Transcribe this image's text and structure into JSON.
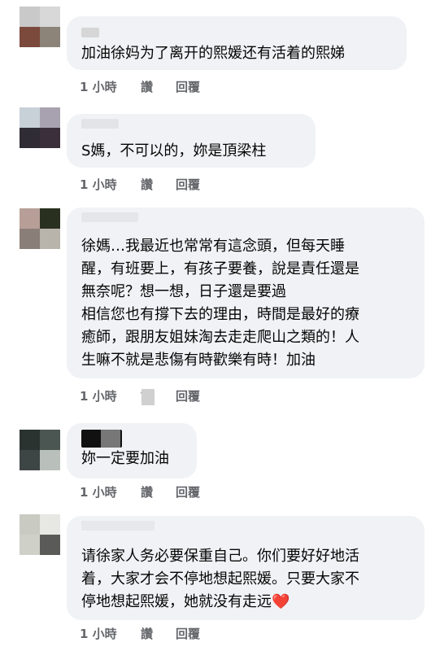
{
  "comments": [
    {
      "text": "加油徐妈为了离开的熙媛还有活着的熙娣",
      "time": "1 小時",
      "like": "讚",
      "reply": "回覆"
    },
    {
      "text": "S媽，不可以的，妳是頂梁柱",
      "time": "1 小時",
      "like": "讚",
      "reply": "回覆"
    },
    {
      "text": "徐媽…我最近也常常有這念頭，但每天睡\n醒，有班要上，有孩子要養，說是責任還是\n無奈呢？想一想，日子還是要過\n相信您也有撐下去的理由，時間是最好的療\n癒師，跟朋友姐妹淘去走走爬山之類的！人\n生嘛不就是悲傷有時歡樂有時！加油",
      "time": "1 小時",
      "like": "讚",
      "reply": "回覆"
    },
    {
      "text": "妳一定要加油",
      "time": "1 小時",
      "like": "讚",
      "reply": "回覆"
    },
    {
      "text": "请徐家人务必要保重自己。你们要好好地活\n着，大家才会不停地想起熙媛。只要大家不\n停地想起熙媛，她就没有走远",
      "emoji": "❤️",
      "time": "1 小時",
      "like": "讚",
      "reply": "回覆"
    }
  ]
}
